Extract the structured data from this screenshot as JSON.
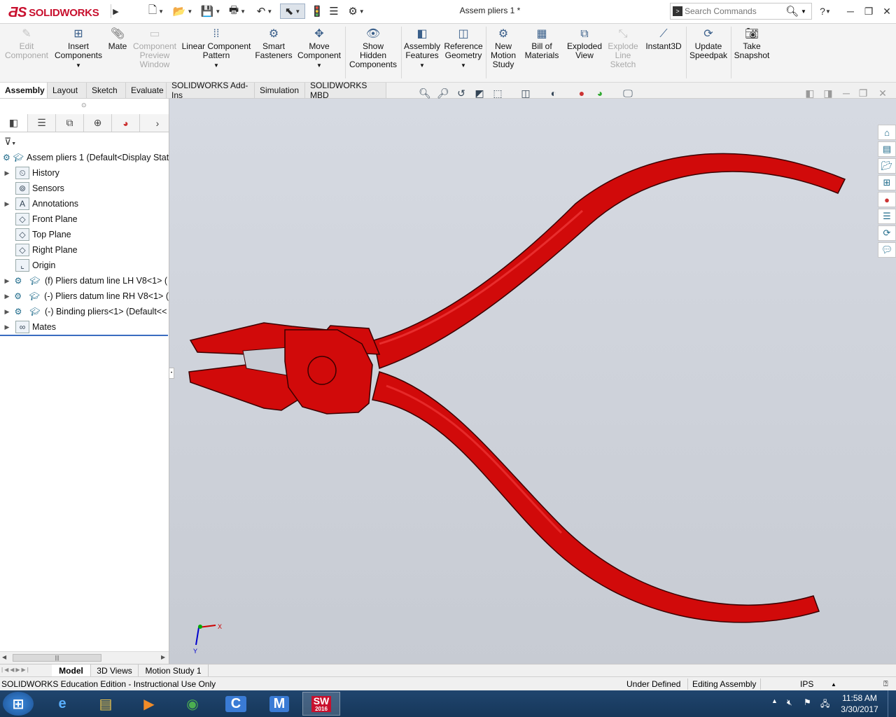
{
  "app": {
    "brand_prefix": "3S",
    "brand_name": "SOLIDWORKS",
    "doc_title": "Assem pliers 1 *"
  },
  "search": {
    "placeholder": "Search Commands"
  },
  "ribbon": [
    {
      "label": "Edit\nComponent",
      "enabled": false
    },
    {
      "label": "Insert\nComponents",
      "enabled": true,
      "dropdown": true
    },
    {
      "label": "Mate",
      "enabled": true
    },
    {
      "label": "Component\nPreview\nWindow",
      "enabled": false
    },
    {
      "label": "Linear Component\nPattern",
      "enabled": true,
      "dropdown": true
    },
    {
      "label": "Smart\nFasteners",
      "enabled": true
    },
    {
      "label": "Move\nComponent",
      "enabled": true,
      "dropdown": true
    },
    {
      "label": "Show\nHidden\nComponents",
      "enabled": true
    },
    {
      "label": "Assembly\nFeatures",
      "enabled": true,
      "dropdown": true
    },
    {
      "label": "Reference\nGeometry",
      "enabled": true,
      "dropdown": true
    },
    {
      "label": "New\nMotion\nStudy",
      "enabled": true
    },
    {
      "label": "Bill of\nMaterials",
      "enabled": true
    },
    {
      "label": "Exploded\nView",
      "enabled": true
    },
    {
      "label": "Explode\nLine\nSketch",
      "enabled": false
    },
    {
      "label": "Instant3D",
      "enabled": true
    },
    {
      "label": "Update\nSpeedpak",
      "enabled": true
    },
    {
      "label": "Take\nSnapshot",
      "enabled": true
    }
  ],
  "tabs": [
    "Assembly",
    "Layout",
    "Sketch",
    "Evaluate",
    "SOLIDWORKS Add-Ins",
    "Simulation",
    "SOLIDWORKS MBD"
  ],
  "active_tab": "Assembly",
  "tree": [
    {
      "label": "Assem pliers 1  (Default<Display Stat",
      "expand": false,
      "level": 0
    },
    {
      "label": "History",
      "expand": true
    },
    {
      "label": "Sensors",
      "expand": false
    },
    {
      "label": "Annotations",
      "expand": true
    },
    {
      "label": "Front Plane",
      "expand": false
    },
    {
      "label": "Top Plane",
      "expand": false
    },
    {
      "label": "Right Plane",
      "expand": false
    },
    {
      "label": "Origin",
      "expand": false
    },
    {
      "label": "(f) Pliers datum line LH V8<1> (",
      "expand": true
    },
    {
      "label": "(-) Pliers datum line RH V8<1> (",
      "expand": true
    },
    {
      "label": "(-) Binding pliers<1> (Default<<",
      "expand": true
    },
    {
      "label": "Mates",
      "expand": true
    }
  ],
  "bottom_tabs": [
    "Model",
    "3D Views",
    "Motion Study 1"
  ],
  "active_bottom_tab": "Model",
  "status": {
    "edition": "SOLIDWORKS Education Edition - Instructional Use Only",
    "state": "Under Defined",
    "mode": "Editing Assembly",
    "units": "IPS"
  },
  "triad": {
    "x_label": "X",
    "y_label": "Y"
  },
  "taskbar": {
    "time": "11:58 AM",
    "date": "3/30/2017",
    "apps": [
      "start-icon",
      "internet-explorer-icon",
      "file-explorer-icon",
      "media-player-icon",
      "chrome-icon",
      "c-app-icon",
      "m-app-icon",
      "solidworks-icon"
    ],
    "sw_badge": "SW",
    "sw_year": "2016"
  },
  "colors": {
    "model": "#d10a0a",
    "accent": "#c8102e",
    "viewport": "#c9cdd5"
  }
}
